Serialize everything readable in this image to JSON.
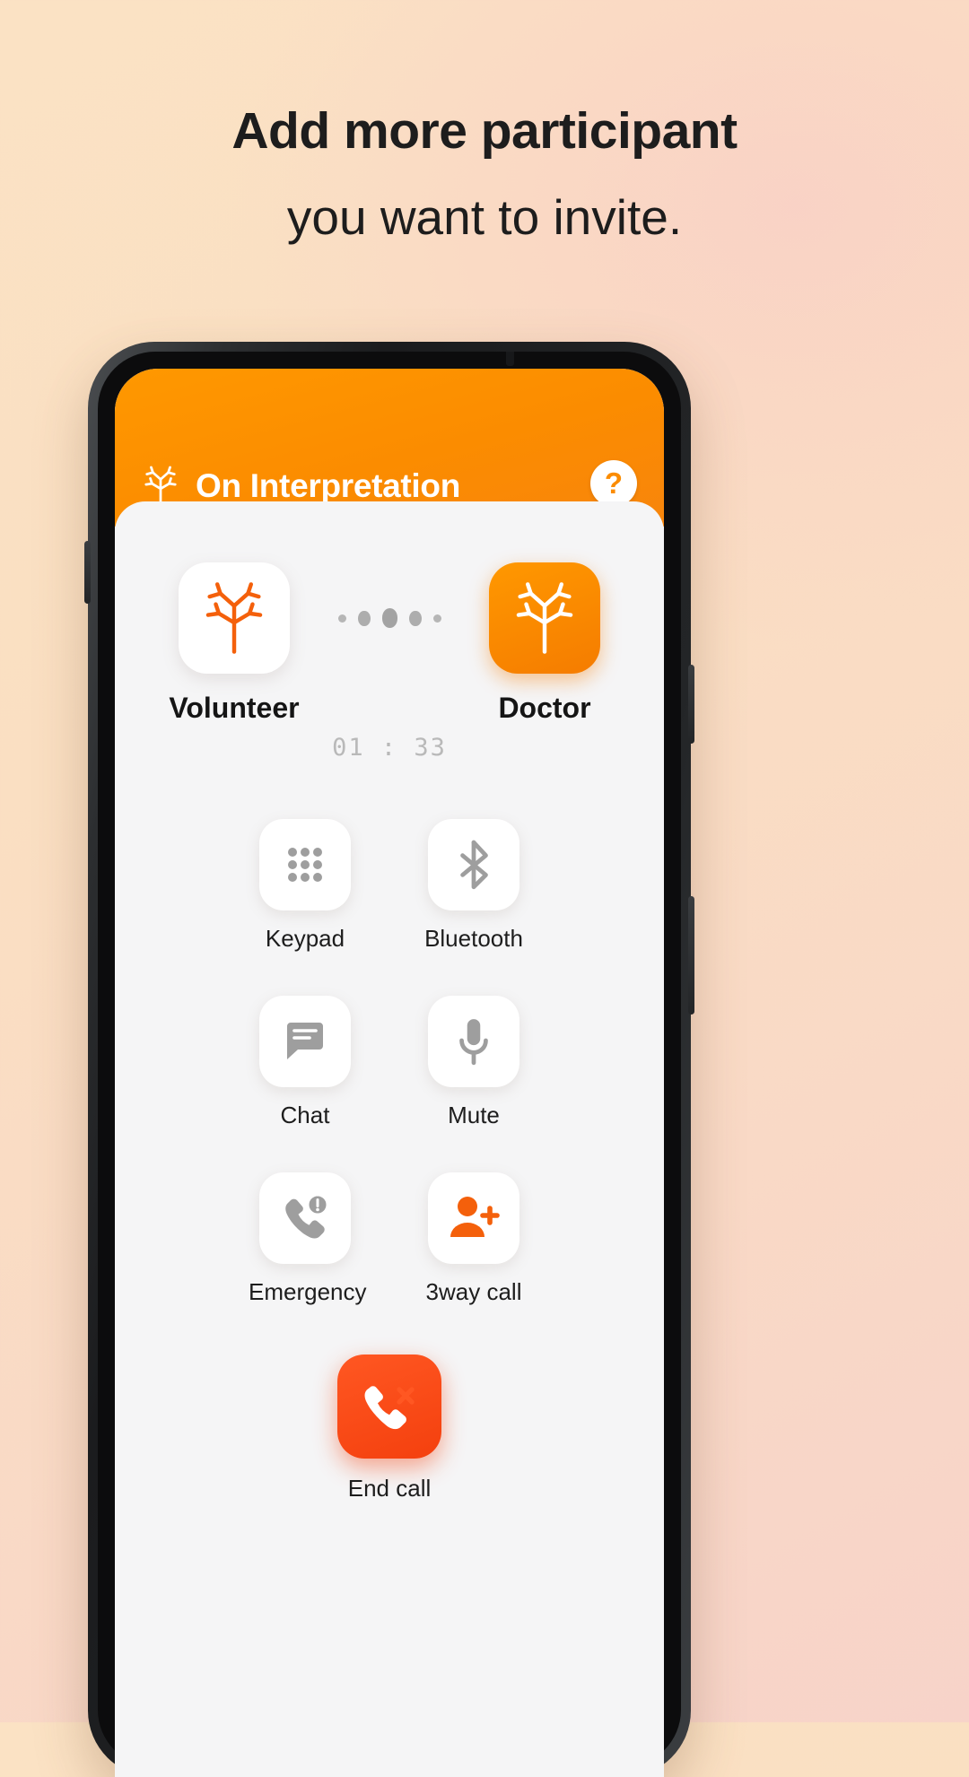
{
  "promo": {
    "line1": "Add more participant",
    "line2": "you want to invite."
  },
  "app": {
    "title": "On Interpretation",
    "logo_icon": "tree-icon",
    "help_icon": "help-question-icon",
    "help_label": "?",
    "header_color": "#FF9000"
  },
  "call": {
    "participants": [
      {
        "name": "Volunteer",
        "icon": "tree-icon",
        "style": "white"
      },
      {
        "name": "Doctor",
        "icon": "tree-icon",
        "style": "orange"
      }
    ],
    "connection_dots": 5,
    "duration": "01 : 33"
  },
  "actions": [
    {
      "label": "Keypad",
      "icon": "keypad-icon"
    },
    {
      "label": "Bluetooth",
      "icon": "bluetooth-icon"
    },
    {
      "label": "Chat",
      "icon": "chat-icon"
    },
    {
      "label": "Mute",
      "icon": "microphone-icon"
    },
    {
      "label": "Emergency",
      "icon": "emergency-call-icon"
    },
    {
      "label": "3way call",
      "icon": "add-person-icon"
    }
  ],
  "end_call": {
    "label": "End call",
    "icon": "end-call-icon",
    "color": "#FF4A1C"
  }
}
